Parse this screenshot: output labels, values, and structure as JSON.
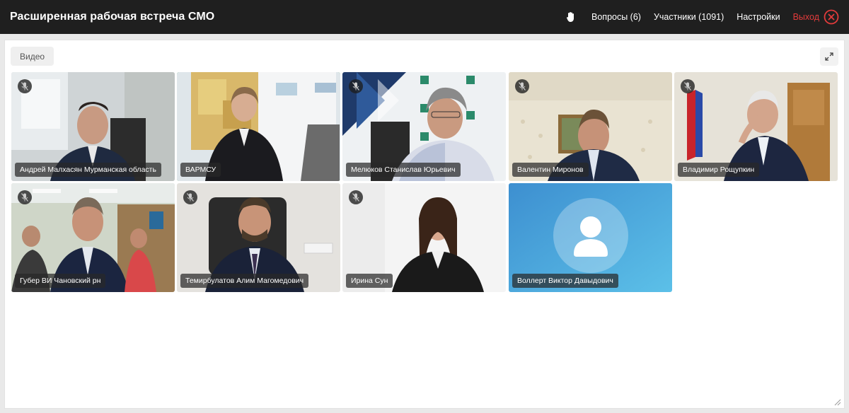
{
  "header": {
    "title": "Расширенная рабочая встреча СМО",
    "questions": "Вопросы (6)",
    "participants": "Участники (1091)",
    "settings": "Настройки",
    "exit": "Выход"
  },
  "panel": {
    "tab_label": "Видео"
  },
  "participants": [
    {
      "name": "Андрей Малхасян Мурманская область"
    },
    {
      "name": "ВАРМСУ"
    },
    {
      "name": "Мелюков Станислав Юрьевич"
    },
    {
      "name": "Валентин Миронов"
    },
    {
      "name": "Владимир Рощупкин"
    },
    {
      "name": "Губер ВИ Чановский рн"
    },
    {
      "name": "Темирбулатов Алим Магомедович"
    },
    {
      "name": "Ирина Сун"
    },
    {
      "name": "Воллерт Виктор Давыдович"
    }
  ],
  "colors": {
    "topbar": "#1f1f1f",
    "exit": "#e23b3b",
    "active_border": "#4caf50",
    "avatar_bg": "#4aa0d8"
  }
}
